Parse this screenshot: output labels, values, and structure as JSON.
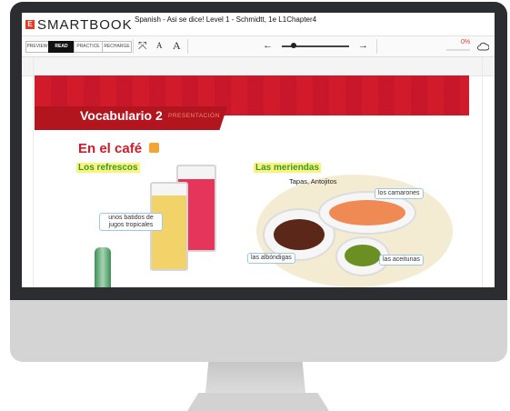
{
  "header": {
    "logo_mark": "E",
    "logo_text": "SMARTBOOK",
    "book_title": "Spanish - Asi se dice! Level 1 - Schmidtt, 1e L1Chapter4"
  },
  "toolbar": {
    "modes": [
      {
        "label": "PREVIEW",
        "active": false
      },
      {
        "label": "READ",
        "active": true
      },
      {
        "label": "PRACTICE",
        "active": false
      },
      {
        "label": "RECHARGE",
        "active": false
      }
    ],
    "fit_icon": "fit-screen-icon",
    "font_small": "A",
    "font_large": "A",
    "prev_arrow": "←",
    "next_arrow": "→",
    "progress_percent": "0%",
    "progress_value": 0,
    "cloud_icon": "cloud-icon"
  },
  "page": {
    "banner_title": "Vocabulario 2",
    "banner_subtitle": "PRESENTACIÓN",
    "section_title": "En el café",
    "left_heading": "Los refrescos",
    "right_heading": "Las meriendas",
    "caption_top": "Tapas, Antojitos",
    "labels": {
      "batidos": "unos batidos de jugos tropicales",
      "camarones": "los camarones",
      "albondigas": "las albóndigas",
      "aceitunas": "las aceitunas"
    }
  },
  "colors": {
    "brand_red": "#d11a2a",
    "heading_green": "#2f9d3a",
    "highlight_yellow": "#fff27a",
    "bezel": "#2b2d30"
  }
}
